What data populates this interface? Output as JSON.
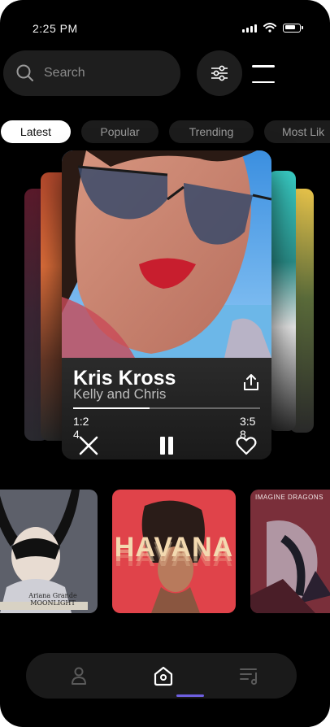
{
  "status_bar": {
    "time": "2:25 PM"
  },
  "search": {
    "placeholder": "Search"
  },
  "tabs": [
    {
      "label": "Latest",
      "active": true
    },
    {
      "label": "Popular",
      "active": false
    },
    {
      "label": "Trending",
      "active": false
    },
    {
      "label": "Most Lik",
      "active": false
    }
  ],
  "now_playing": {
    "title": "Kris Kross",
    "artist": "Kelly and Chris",
    "elapsed": "1:24",
    "duration": "3:58",
    "progress": 0.41,
    "state": "playing"
  },
  "albums": [
    {
      "cover_text": "Ariana Grande MOONLIGHT",
      "accent": "#cfcfd6"
    },
    {
      "cover_text": "HAVANA",
      "accent": "#e0434a"
    },
    {
      "cover_text": "IMAGINE DRAGONS",
      "accent": "#7a2f3a"
    }
  ],
  "nav": {
    "items": [
      "profile-icon",
      "home-icon",
      "playlist-icon"
    ],
    "active": "home-icon",
    "accent": "#6e5fe0"
  }
}
